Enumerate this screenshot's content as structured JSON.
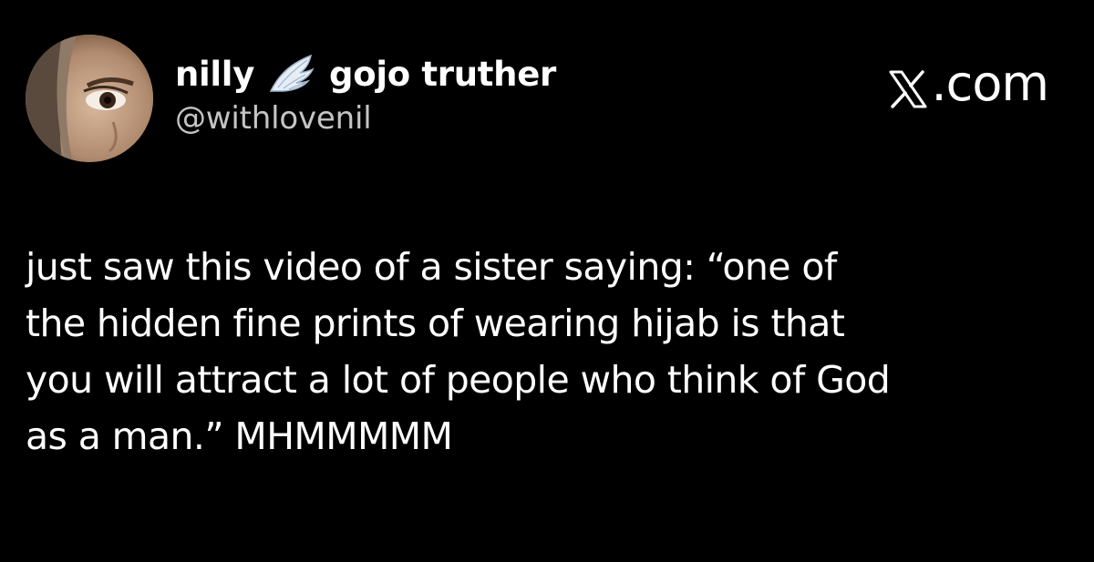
{
  "author": {
    "display_name_part1": "nilly",
    "display_name_emoji": "wing-icon",
    "display_name_part2": "gojo truther",
    "handle": "@withlovenil",
    "avatar": "avatar-photo"
  },
  "brand": {
    "icon": "x-logo-icon",
    "label": ".com"
  },
  "tweet": {
    "lines": [
      "just saw this video of a sister saying: “one of",
      "the hidden fine prints of wearing hijab is that",
      "you will attract a lot of people who think of God",
      "as a man.” MHMMMMM"
    ]
  },
  "colors": {
    "background": "#000000",
    "text": "#ffffff",
    "handle": "#c4c4c4"
  }
}
